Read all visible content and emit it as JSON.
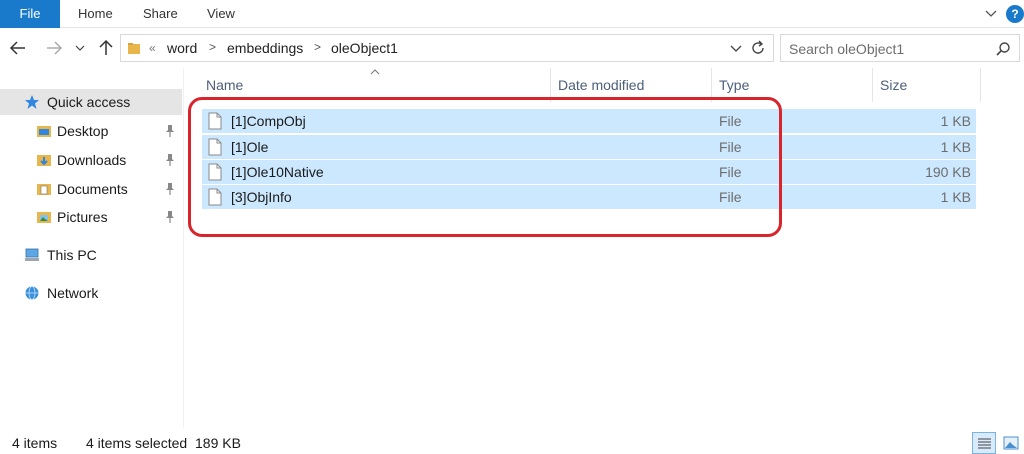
{
  "ribbon": {
    "tabs": [
      "File",
      "Home",
      "Share",
      "View"
    ],
    "help_label": "?"
  },
  "address": {
    "overflow": "«",
    "crumbs": [
      "word",
      "embeddings",
      "oleObject1"
    ],
    "separator": ">"
  },
  "search": {
    "placeholder": "Search oleObject1"
  },
  "sidebar": {
    "items": [
      {
        "label": "Quick access",
        "icon": "star-icon",
        "active": true
      },
      {
        "label": "Desktop",
        "icon": "desktop-folder-icon",
        "pinned": true
      },
      {
        "label": "Downloads",
        "icon": "downloads-folder-icon",
        "pinned": true
      },
      {
        "label": "Documents",
        "icon": "documents-folder-icon",
        "pinned": true
      },
      {
        "label": "Pictures",
        "icon": "pictures-folder-icon",
        "pinned": true
      },
      {
        "label": "This PC",
        "icon": "computer-icon"
      },
      {
        "label": "Network",
        "icon": "network-icon"
      }
    ]
  },
  "columns": {
    "name": "Name",
    "date_modified": "Date modified",
    "type": "Type",
    "size": "Size"
  },
  "files": [
    {
      "name": "[1]CompObj",
      "date": "",
      "type": "File",
      "size": "1 KB",
      "selected": true
    },
    {
      "name": "[1]Ole",
      "date": "",
      "type": "File",
      "size": "1 KB",
      "selected": true
    },
    {
      "name": "[1]Ole10Native",
      "date": "",
      "type": "File",
      "size": "190 KB",
      "selected": true
    },
    {
      "name": "[3]ObjInfo",
      "date": "",
      "type": "File",
      "size": "1 KB",
      "selected": true
    }
  ],
  "status": {
    "item_count": "4 items",
    "selected": "4 items selected",
    "selected_size": "189 KB"
  },
  "colors": {
    "accent": "#1979ca",
    "selection": "#cce8ff",
    "annotation": "#d9242c"
  }
}
